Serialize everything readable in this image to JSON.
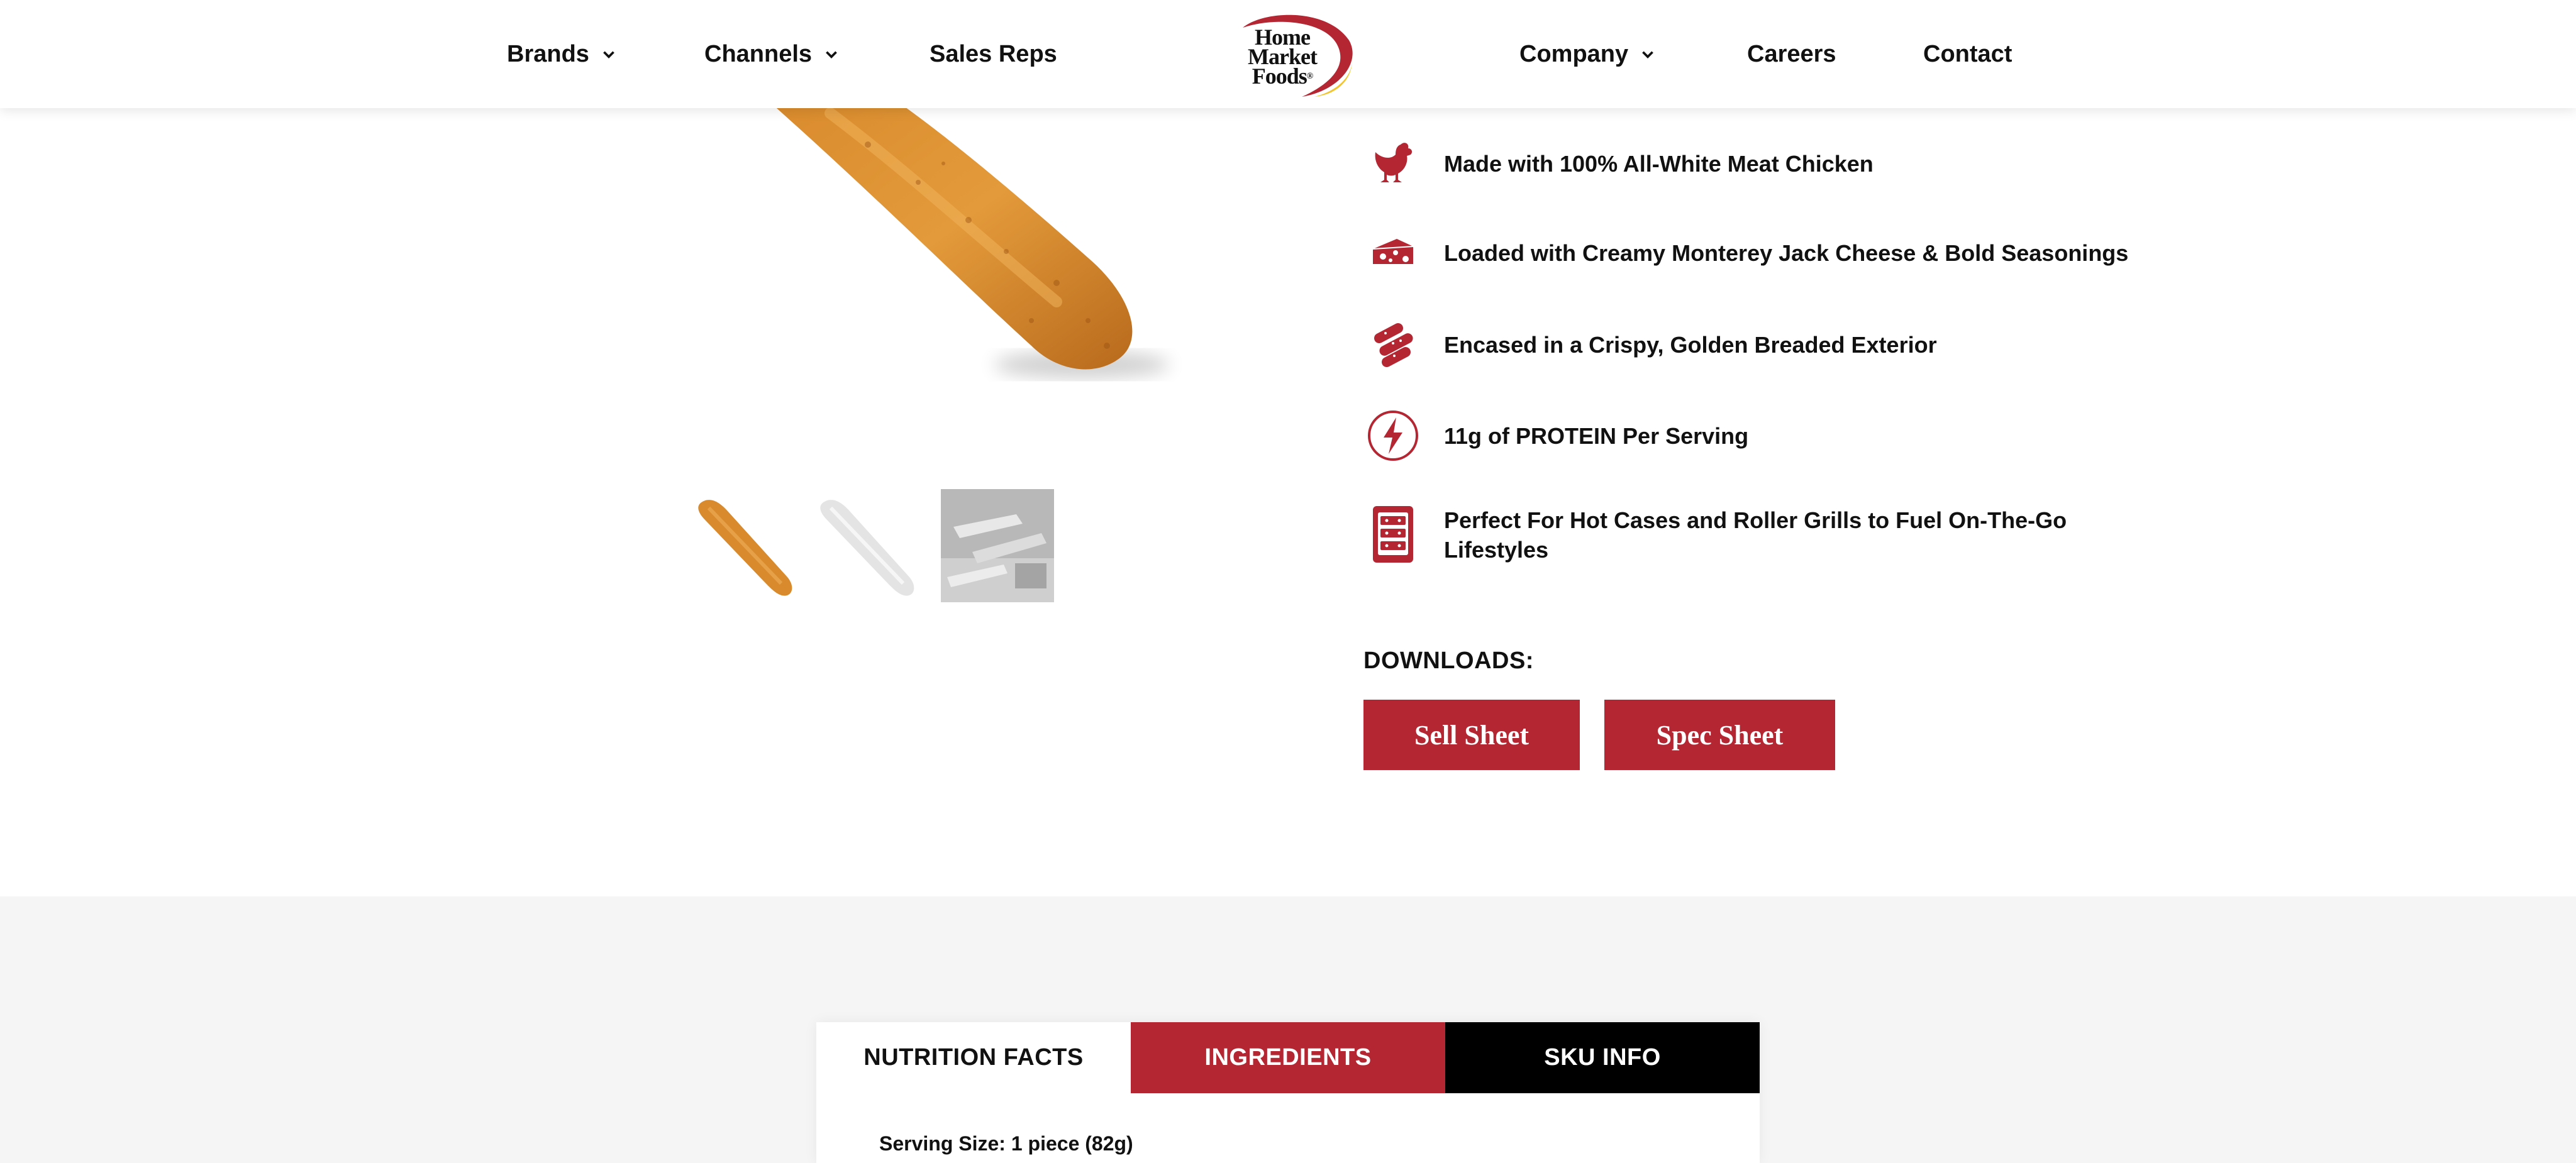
{
  "header": {
    "nav_left": [
      {
        "label": "Brands",
        "has_dropdown": true
      },
      {
        "label": "Channels",
        "has_dropdown": true
      },
      {
        "label": "Sales Reps",
        "has_dropdown": false
      }
    ],
    "logo": {
      "line1": "Home",
      "line2": "Market",
      "line3": "Foods",
      "mark": "®"
    },
    "nav_right": [
      {
        "label": "Company",
        "has_dropdown": true
      },
      {
        "label": "Careers",
        "has_dropdown": false
      },
      {
        "label": "Contact",
        "has_dropdown": false
      }
    ]
  },
  "product": {
    "thumbnail_count": 3,
    "active_thumbnail": 1
  },
  "features": [
    {
      "icon": "chicken-icon",
      "text": "Made with 100% All-White Meat Chicken"
    },
    {
      "icon": "cheese-icon",
      "text": "Loaded with Creamy Monterey Jack Cheese & Bold Seasonings"
    },
    {
      "icon": "breading-icon",
      "text": "Encased in a Crispy, Golden Breaded Exterior"
    },
    {
      "icon": "lightning-icon",
      "text": "11g of PROTEIN Per Serving"
    },
    {
      "icon": "hot-case-icon",
      "text": "Perfect For Hot Cases and Roller Grills to Fuel On-The-Go Lifestyles"
    }
  ],
  "downloads": {
    "title": "DOWNLOADS:",
    "buttons": [
      {
        "label": "Sell Sheet"
      },
      {
        "label": "Spec Sheet"
      }
    ]
  },
  "nutrition": {
    "tabs": [
      {
        "label": "NUTRITION FACTS",
        "active": true
      },
      {
        "label": "INGREDIENTS",
        "active": false
      },
      {
        "label": "SKU INFO",
        "active": false
      }
    ],
    "serving_size": "Serving Size: 1 piece (82g)"
  },
  "colors": {
    "brand_red": "#b52633",
    "black": "#000000",
    "section_gray": "#f5f5f5",
    "logo_yellow": "#f2c530"
  }
}
